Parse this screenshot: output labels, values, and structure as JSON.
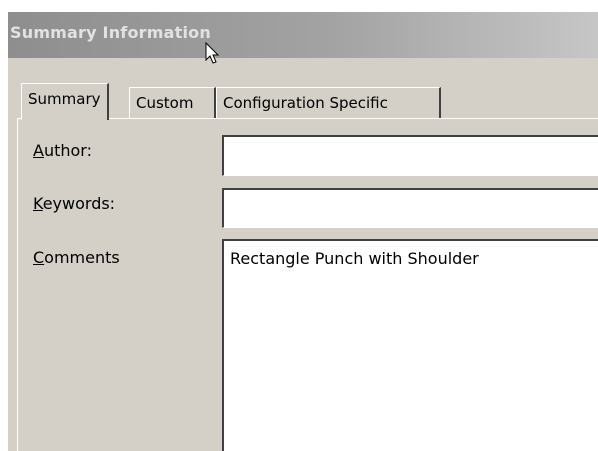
{
  "window": {
    "title": "Summary Information"
  },
  "tabs": [
    {
      "label": "Summary",
      "active": true
    },
    {
      "label": "Custom",
      "active": false
    },
    {
      "label": "Configuration Specific",
      "active": false
    }
  ],
  "form": {
    "author": {
      "label_accel": "A",
      "label_rest": "uthor:",
      "value": ""
    },
    "keywords": {
      "label_accel": "K",
      "label_rest": "eywords:",
      "value": ""
    },
    "comments": {
      "label_accel": "C",
      "label_rest": "omments",
      "value": "Rectangle Punch with Shoulder"
    }
  },
  "colors": {
    "dialog_bg": "#d4d0c8",
    "title_gradient_start": "#8e8e8e",
    "title_gradient_end": "#c6c6c6",
    "title_text": "#e2e2e2"
  }
}
